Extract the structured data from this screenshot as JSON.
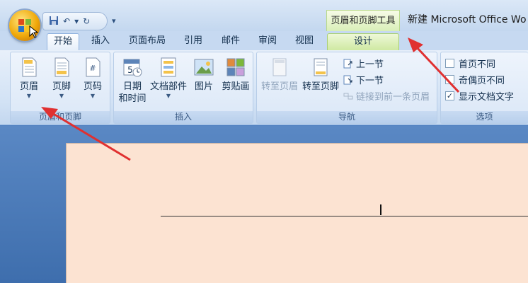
{
  "title_bar": {
    "contextual_title": "页眉和页脚工具",
    "document_title": "新建 Microsoft Office Wo"
  },
  "tabs": [
    {
      "label": "开始"
    },
    {
      "label": "插入"
    },
    {
      "label": "页面布局"
    },
    {
      "label": "引用"
    },
    {
      "label": "邮件"
    },
    {
      "label": "审阅"
    },
    {
      "label": "视图"
    },
    {
      "label": "设计"
    }
  ],
  "groups": {
    "header_footer": {
      "label": "页眉和页脚",
      "buttons": [
        {
          "label": "页眉",
          "icon": "header-icon"
        },
        {
          "label": "页脚",
          "icon": "footer-icon"
        },
        {
          "label": "页码",
          "icon": "page-number-icon"
        }
      ]
    },
    "insert": {
      "label": "插入",
      "buttons": [
        {
          "label_line1": "日期",
          "label_line2": "和时间",
          "icon": "calendar-icon"
        },
        {
          "label": "文档部件",
          "icon": "quick-parts-icon"
        },
        {
          "label": "图片",
          "icon": "picture-icon"
        },
        {
          "label": "剪贴画",
          "icon": "clipart-icon"
        }
      ]
    },
    "navigation": {
      "label": "导航",
      "buttons": [
        {
          "label": "转至页眉",
          "icon": "goto-header-icon"
        },
        {
          "label": "转至页脚",
          "icon": "goto-footer-icon"
        }
      ],
      "small": [
        {
          "label": "上一节",
          "icon": "previous-section-icon"
        },
        {
          "label": "下一节",
          "icon": "next-section-icon"
        },
        {
          "label": "链接到前一条页眉",
          "icon": "link-previous-icon"
        }
      ]
    },
    "options": {
      "label": "选项",
      "checks": [
        {
          "label": "首页不同",
          "checked": false
        },
        {
          "label": "奇偶页不同",
          "checked": false
        },
        {
          "label": "显示文档文字",
          "checked": true
        }
      ]
    }
  },
  "colors": {
    "annotation_arrow": "#e03030",
    "page": "#fce3d2",
    "contextual_tab": "#cfe9a2"
  }
}
